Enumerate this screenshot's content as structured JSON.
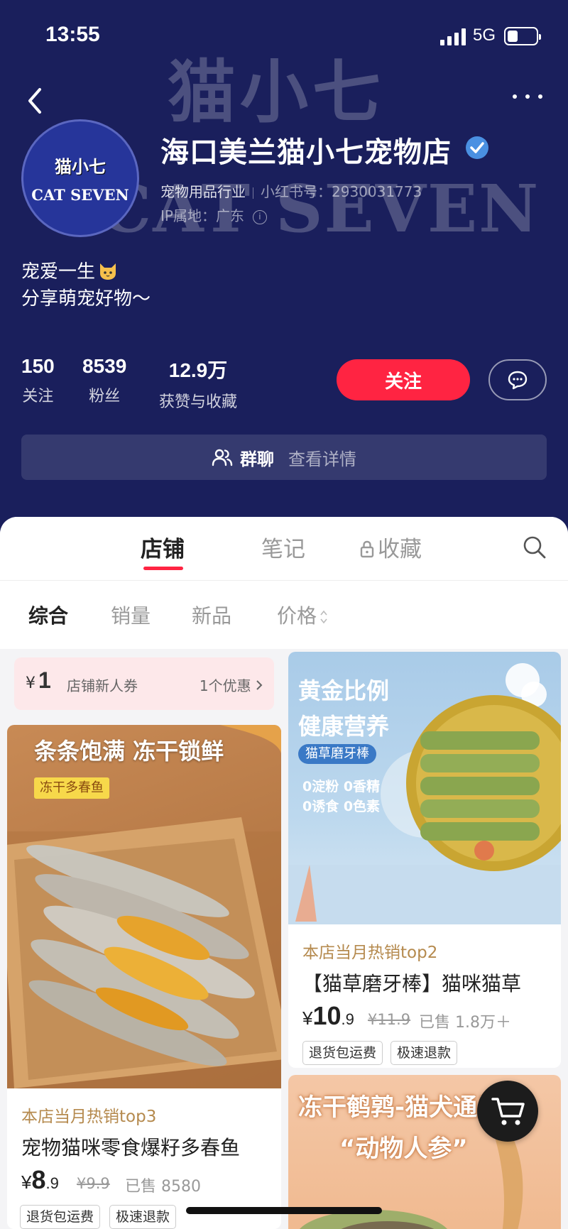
{
  "status": {
    "time": "13:55",
    "network": "5G"
  },
  "header": {
    "watermark_cn": "猫小七",
    "watermark_en": "CAT SEVEN",
    "avatar_line1": "猫小七",
    "avatar_line2": "CAT SEVEN",
    "store_name": "海口美兰猫小七宠物店",
    "industry": "宠物用品行业",
    "rednote_id": "小红书号：2930031773",
    "ip": "IP属地：广东",
    "bio_line1": "宠爱一生",
    "bio_line2": "分享萌宠好物～",
    "stats": [
      {
        "num": "150",
        "label": "关注"
      },
      {
        "num": "8539",
        "label": "粉丝"
      },
      {
        "num": "12.9万",
        "label": "获赞与收藏"
      }
    ],
    "follow_label": "关注",
    "group_label": "群聊",
    "group_detail": "查看详情"
  },
  "tabs": [
    "店铺",
    "笔记",
    "收藏"
  ],
  "sorts": [
    "综合",
    "销量",
    "新品",
    "价格"
  ],
  "coupon": {
    "yen": "¥",
    "amount": "1",
    "title": "店铺新人券",
    "more": "1个优惠"
  },
  "products": [
    {
      "banner": "条条饱满 冻干锁鲜",
      "badge": "冻干多春鱼",
      "tag": "本店当月热销top3",
      "title": "宠物猫咪零食爆籽多春鱼",
      "price_int": "8",
      "price_dec": ".9",
      "orig": "¥9.9",
      "sold": "已售 8580",
      "chips": [
        "退货包运费",
        "极速退款"
      ]
    },
    {
      "banner1": "黄金比例",
      "banner2": "健康营养",
      "badge": "猫草磨牙棒",
      "features": [
        "0淀粉 0香精",
        "0诱食 0色素"
      ],
      "tag": "本店当月热销top2",
      "title": "【猫草磨牙棒】猫咪猫草",
      "price_int": "10",
      "price_dec": ".9",
      "orig": "¥11.9",
      "sold": "已售 1.8万＋",
      "chips": [
        "退货包运费",
        "极速退款"
      ]
    },
    {
      "banner1": "冻干鹌鹑-猫犬通用",
      "banner2": "“动物人参”"
    }
  ],
  "colors": {
    "header_bg": "#1a1f5c",
    "accent": "#ff2442",
    "tag": "#b58a4e"
  }
}
